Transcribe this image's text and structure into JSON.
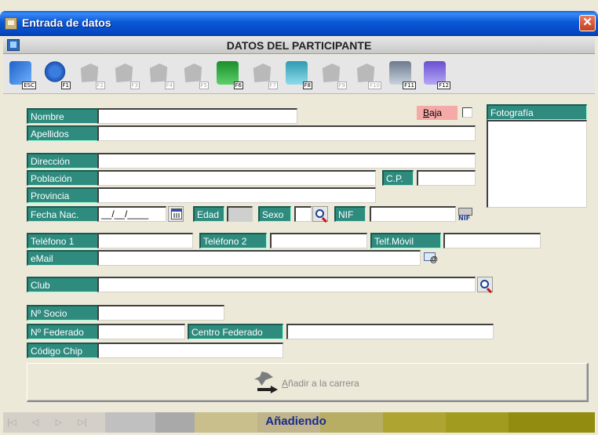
{
  "window": {
    "title": "Entrada de datos",
    "close_glyph": "✕"
  },
  "section": {
    "title": "DATOS DEL PARTICIPANTE"
  },
  "toolbar": {
    "buttons": [
      {
        "key": "ESC",
        "icon": "back-arrow-icon",
        "enabled": true
      },
      {
        "key": "F1",
        "icon": "help-icon",
        "enabled": true
      },
      {
        "key": "F2",
        "icon": "disabled-icon",
        "enabled": false
      },
      {
        "key": "F3",
        "icon": "disabled-icon",
        "enabled": false
      },
      {
        "key": "F4",
        "icon": "disabled-icon",
        "enabled": false
      },
      {
        "key": "F5",
        "icon": "disabled-icon",
        "enabled": false
      },
      {
        "key": "F6",
        "icon": "new-record-icon",
        "enabled": true
      },
      {
        "key": "F7",
        "icon": "disabled-icon",
        "enabled": false
      },
      {
        "key": "F8",
        "icon": "undo-icon",
        "enabled": true
      },
      {
        "key": "F9",
        "icon": "disabled-icon",
        "enabled": false
      },
      {
        "key": "F10",
        "icon": "disabled-icon",
        "enabled": false
      },
      {
        "key": "F11",
        "icon": "print-icon",
        "enabled": true
      },
      {
        "key": "F12",
        "icon": "check-icon",
        "enabled": true
      }
    ]
  },
  "form": {
    "nombre": {
      "label": "Nombre",
      "value": ""
    },
    "baja": {
      "label_underlined": "B",
      "label_rest": "aja",
      "checked": false
    },
    "fotografia": {
      "label": "Fotografía"
    },
    "apellidos": {
      "label": "Apellidos",
      "value": ""
    },
    "direccion": {
      "label": "Dirección",
      "value": ""
    },
    "poblacion": {
      "label": "Población",
      "value": ""
    },
    "cp": {
      "label": "C.P.",
      "value": ""
    },
    "provincia": {
      "label": "Provincia",
      "value": ""
    },
    "fecha_nac": {
      "label": "Fecha Nac.",
      "value": "__/__/____"
    },
    "edad": {
      "label": "Edad",
      "value": ""
    },
    "sexo": {
      "label": "Sexo",
      "value": ""
    },
    "nif": {
      "label": "NIF",
      "value": "",
      "icon_text": "NIF"
    },
    "telefono1": {
      "label": "Teléfono 1",
      "value": ""
    },
    "telefono2": {
      "label": "Teléfono 2",
      "value": ""
    },
    "telf_movil": {
      "label": "Telf.Móvil",
      "value": ""
    },
    "email": {
      "label": "eMail",
      "value": ""
    },
    "club": {
      "label": "Club",
      "value": ""
    },
    "n_socio": {
      "label": "Nº Socio",
      "value": ""
    },
    "n_federado": {
      "label": "Nº Federado",
      "value": ""
    },
    "centro_federado": {
      "label": "Centro Federado",
      "value": ""
    },
    "codigo_chip": {
      "label": "Código Chip",
      "value": ""
    }
  },
  "action": {
    "add_underlined": "A",
    "add_rest": "ñadir a la carrera",
    "enabled": false
  },
  "statusbar": {
    "nav": [
      "|◁",
      "◁",
      "▷",
      "▷|"
    ],
    "status": "Añadiendo",
    "colors": [
      "#d4d0c8",
      "#c0c0c0",
      "#a9a9a9",
      "#c8bf8c",
      "#bfb48a",
      "#b7ad63",
      "#aea431",
      "#a19c1f",
      "#928d10"
    ]
  }
}
